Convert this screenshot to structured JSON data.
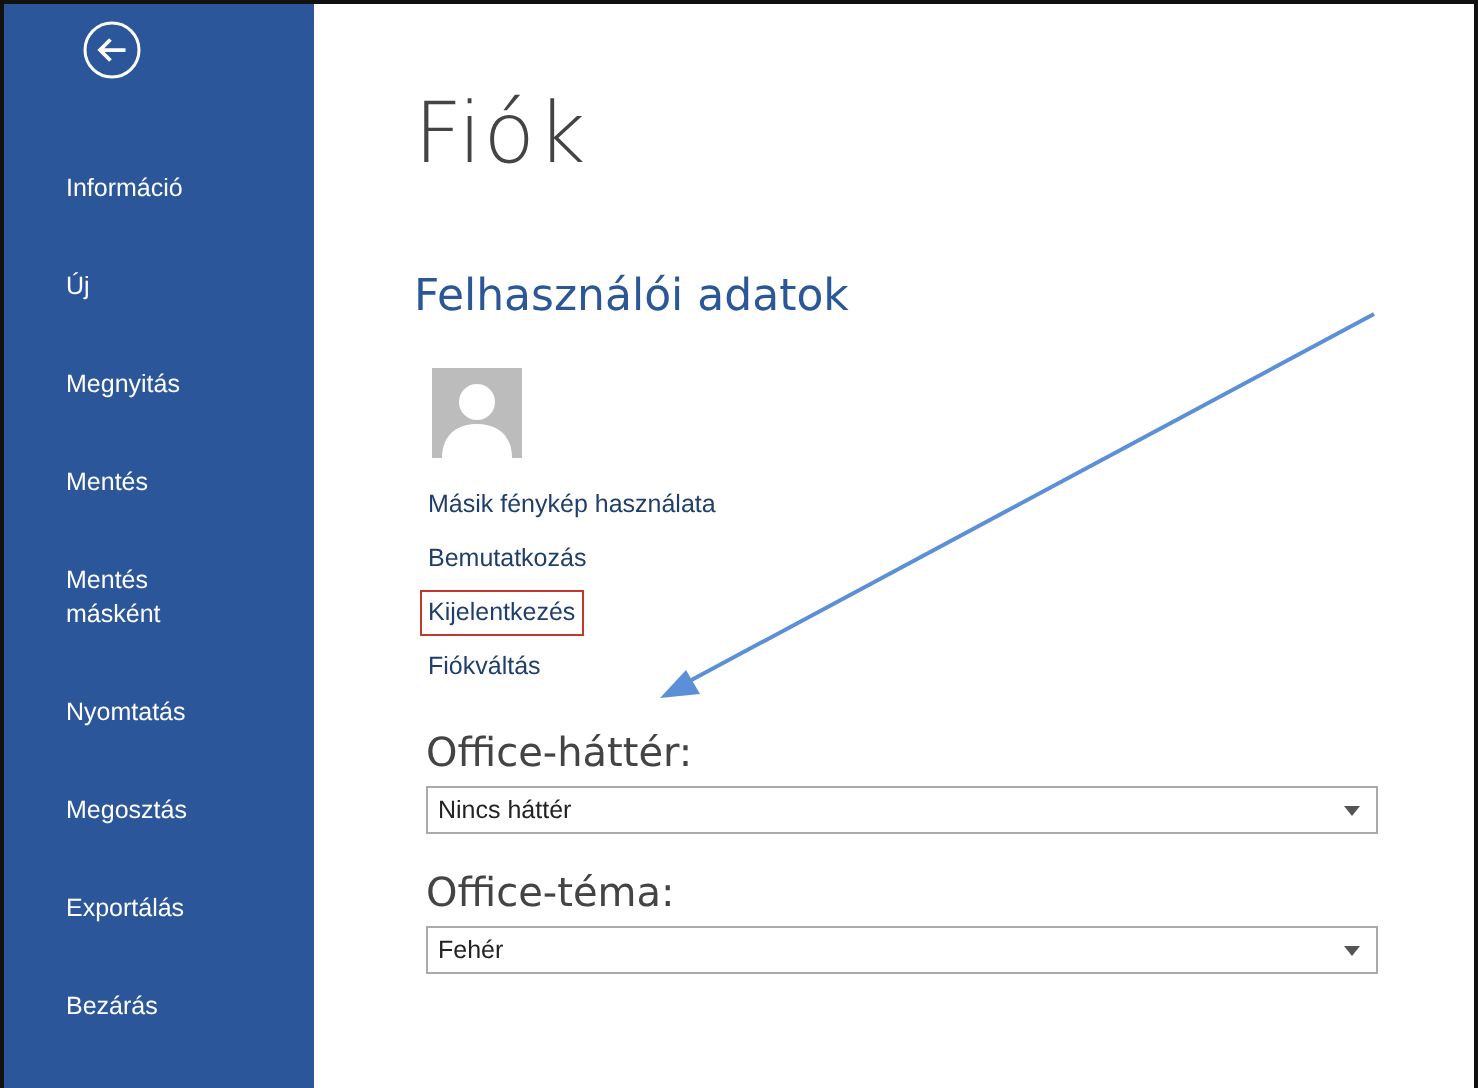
{
  "sidebar": {
    "items": [
      {
        "label": "Információ"
      },
      {
        "label": "Új"
      },
      {
        "label": "Megnyitás"
      },
      {
        "label": "Mentés"
      },
      {
        "label": "Mentés\nmásként"
      },
      {
        "label": "Nyomtatás"
      },
      {
        "label": "Megosztás"
      },
      {
        "label": "Exportálás"
      },
      {
        "label": "Bezárás"
      }
    ]
  },
  "title": "Fiók",
  "user_info": {
    "heading": "Felhasználói adatok",
    "links": [
      {
        "label": "Másik fénykép használata",
        "highlighted": false
      },
      {
        "label": "Bemutatkozás",
        "highlighted": false
      },
      {
        "label": "Kijelentkezés",
        "highlighted": true
      },
      {
        "label": "Fiókváltás",
        "highlighted": false
      }
    ]
  },
  "settings": [
    {
      "label": "Office-háttér:",
      "value": "Nincs háttér"
    },
    {
      "label": "Office-téma:",
      "value": "Fehér"
    }
  ]
}
